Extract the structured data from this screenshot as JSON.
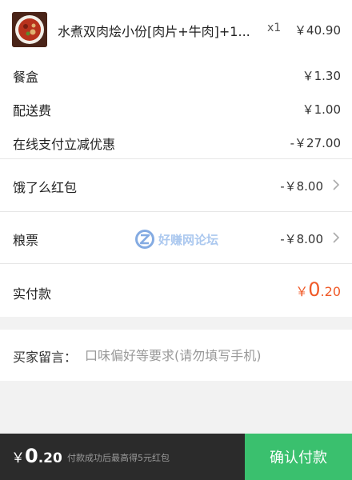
{
  "order": {
    "item": {
      "name": "水煮双肉烩小份[肉片+牛肉]+1...",
      "qty": "x1",
      "price": "￥40.90"
    },
    "fees": [
      {
        "label": "餐盒",
        "value": "￥1.30"
      },
      {
        "label": "配送费",
        "value": "￥1.00"
      },
      {
        "label": "在线支付立减优惠",
        "value": "-￥27.00"
      }
    ],
    "discounts": [
      {
        "label": "饿了么红包",
        "value": "-￥8.00"
      },
      {
        "label": "粮票",
        "value": "-￥8.00"
      }
    ],
    "paid": {
      "label": "实付款",
      "currency": "￥",
      "integer": "0",
      "decimal": ".20"
    }
  },
  "note": {
    "label": "买家留言：",
    "placeholder": "口味偏好等要求(请勿填写手机)"
  },
  "watermark": {
    "text": "好赚网论坛"
  },
  "bottom": {
    "currency": "￥",
    "integer": "0",
    "decimal": ".20",
    "hint": "付款成功后最高得5元红包",
    "confirm_label": "确认付款"
  },
  "colors": {
    "accent_orange": "#f05a28",
    "confirm_green": "#3ac06e",
    "bottom_bar": "#2b2b2b"
  }
}
